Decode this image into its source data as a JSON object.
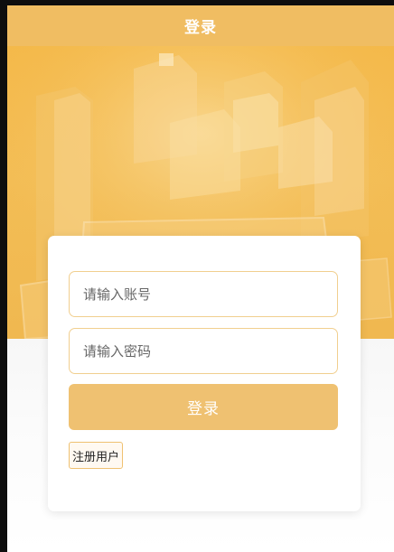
{
  "header": {
    "title": "登录"
  },
  "form": {
    "account_placeholder": "请输入账号",
    "password_placeholder": "请输入密码",
    "login_label": "登录",
    "register_label": "注册用户"
  },
  "colors": {
    "accent": "#f0bd62",
    "button": "#efc171",
    "banner": "#f4b94a",
    "input_border": "#f1cf8f"
  }
}
